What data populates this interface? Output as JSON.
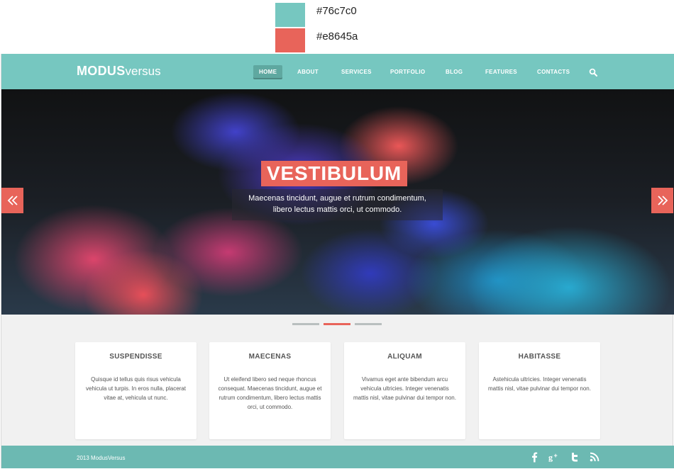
{
  "palette": {
    "swatches": [
      {
        "color": "#76c7c0",
        "label": "#76c7c0"
      },
      {
        "color": "#e8645a",
        "label": "#e8645a"
      }
    ]
  },
  "header": {
    "logo_strong": "MODUS",
    "logo_light": "versus",
    "nav": [
      "HOME",
      "ABOUT",
      "SERVICES",
      "PORTFOLIO",
      "BLOG",
      "FEATURES",
      "CONTACTS"
    ],
    "active_nav": "HOME",
    "search_icon": "search-icon"
  },
  "hero": {
    "title": "VESTIBULUM",
    "caption_line1": "Maecenas tincidunt, augue et rutrum condimentum,",
    "caption_line2": "libero lectus mattis orci, ut commodo.",
    "prev_icon": "double-chevron-left-icon",
    "next_icon": "double-chevron-right-icon",
    "slides_count": 3,
    "active_slide": 2
  },
  "cards": [
    {
      "title": "SUSPENDISSE",
      "text": "Quisque id tellus quis risus vehicula vehicula ut turpis. In eros nulla, placerat vitae at, vehicula ut nunc."
    },
    {
      "title": "MAECENAS",
      "text": "Ut eleifend libero sed neque rhoncus consequat. Maecenas tincidunt, augue et rutrum condimentum, libero lectus mattis orci, ut commodo."
    },
    {
      "title": "ALIQUAM",
      "text": "Vivamus eget ante bibendum arcu vehicula ultricies. Integer venenatis mattis nisl, vitae pulvinar dui tempor non."
    },
    {
      "title": "HABITASSE",
      "text": "Astehicula ultricies. Integer venenatis mattis nisl, vitae pulvinar dui tempor non."
    }
  ],
  "footer": {
    "copyright": "2013  ModusVersus",
    "social": [
      "facebook-icon",
      "google-plus-icon",
      "twitter-icon",
      "rss-icon"
    ]
  },
  "colors": {
    "primary": "#76c7c0",
    "accent": "#e8645a",
    "footer": "#6cb9b2"
  }
}
